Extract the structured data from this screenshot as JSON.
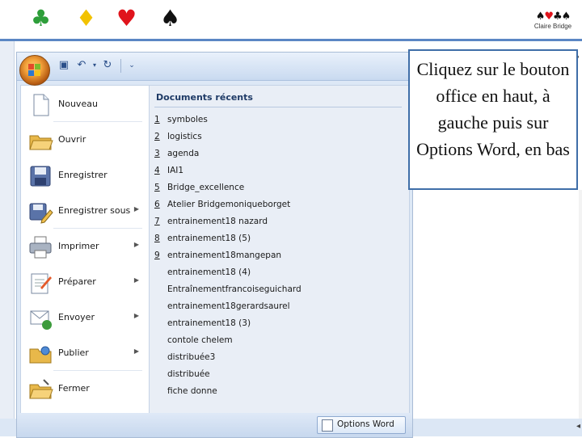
{
  "header": {
    "suits": [
      {
        "glyph": "♣",
        "color": "#2e9e3a",
        "name": "club-icon"
      },
      {
        "glyph": "♦",
        "color": "#f2c200",
        "name": "diamond-icon"
      },
      {
        "glyph": "♥",
        "color": "#e0141c",
        "name": "heart-icon"
      },
      {
        "glyph": "♠",
        "color": "#111111",
        "name": "spade-icon"
      }
    ],
    "logo_text": "Claire Bridge"
  },
  "colors": {
    "accent": "#5b87c4",
    "callout_border": "#3f6ea8",
    "office_orange": "#f2a13a"
  },
  "menu": {
    "items": [
      {
        "label": "Nouveau",
        "icon": "new-document-icon",
        "has_submenu": false
      },
      {
        "label": "Ouvrir",
        "icon": "open-folder-icon",
        "has_submenu": false
      },
      {
        "label": "Enregistrer",
        "icon": "save-disk-icon",
        "has_submenu": false
      },
      {
        "label": "Enregistrer sous",
        "icon": "save-as-icon",
        "has_submenu": true
      },
      {
        "label": "Imprimer",
        "icon": "printer-icon",
        "has_submenu": true
      },
      {
        "label": "Préparer",
        "icon": "prepare-icon",
        "has_submenu": true
      },
      {
        "label": "Envoyer",
        "icon": "send-icon",
        "has_submenu": true
      },
      {
        "label": "Publier",
        "icon": "publish-icon",
        "has_submenu": true
      },
      {
        "label": "Fermer",
        "icon": "close-folder-icon",
        "has_submenu": false
      }
    ]
  },
  "recent": {
    "title": "Documents récents",
    "items": [
      {
        "num": "1",
        "name": "symboles"
      },
      {
        "num": "2",
        "name": "logistics"
      },
      {
        "num": "3",
        "name": "agenda"
      },
      {
        "num": "4",
        "name": "IAI1"
      },
      {
        "num": "5",
        "name": "Bridge_excellence"
      },
      {
        "num": "6",
        "name": "Atelier Bridgemoniqueborget"
      },
      {
        "num": "7",
        "name": "entrainement18 nazard"
      },
      {
        "num": "8",
        "name": "entrainement18 (5)"
      },
      {
        "num": "9",
        "name": "entrainement18mangepan"
      },
      {
        "num": "",
        "name": "entrainement18 (4)"
      },
      {
        "num": "",
        "name": "Entraînementfrancoiseguichard"
      },
      {
        "num": "",
        "name": "entrainement18gerardsaurel"
      },
      {
        "num": "",
        "name": "entrainement18 (3)"
      },
      {
        "num": "",
        "name": "contole chelem"
      },
      {
        "num": "",
        "name": "distribuée3"
      },
      {
        "num": "",
        "name": "distribuée"
      },
      {
        "num": "",
        "name": "fiche donne"
      }
    ]
  },
  "footer": {
    "options_label": "Options Word"
  },
  "callout": {
    "text": "Cliquez sur le bouton office en haut, à gauche puis sur Options Word, en bas"
  }
}
